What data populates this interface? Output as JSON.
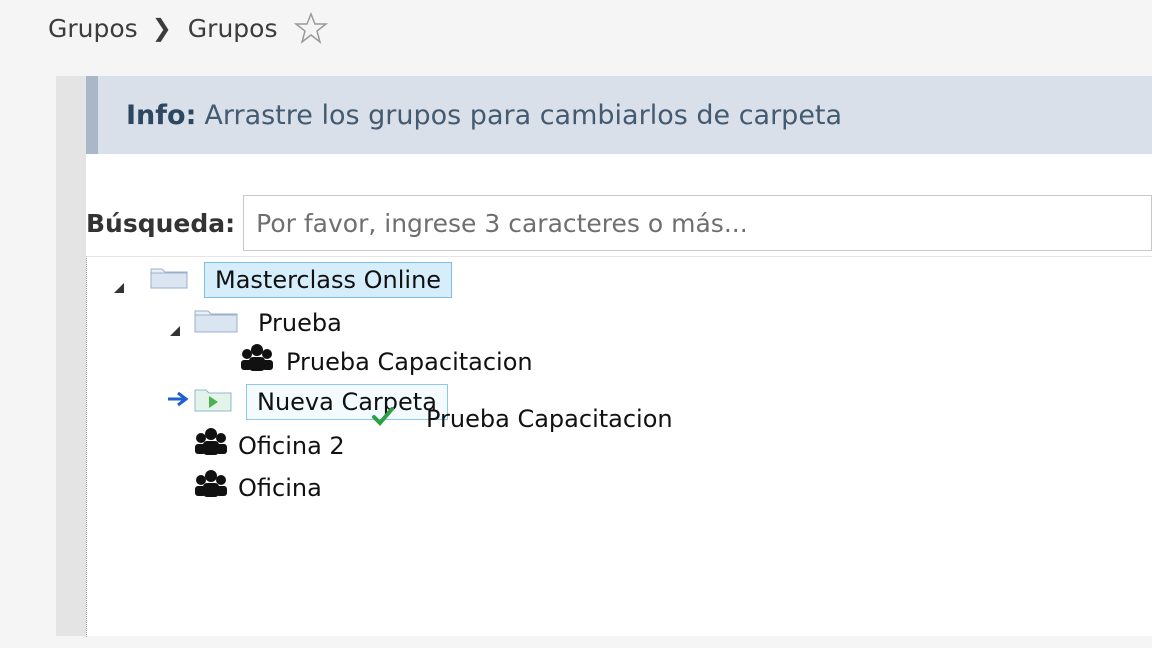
{
  "breadcrumb": {
    "parent": "Grupos",
    "current": "Grupos"
  },
  "info": {
    "label": "Info:",
    "message": "Arrastre los grupos para cambiarlos de carpeta"
  },
  "search": {
    "label": "Búsqueda:",
    "placeholder": "Por favor, ingrese 3 caracteres o más..."
  },
  "tree": {
    "root": "Masterclass Online",
    "folder_prueba": "Prueba",
    "group_prueba_capacitacion": "Prueba Capacitacion",
    "folder_nueva_carpeta": "Nueva Carpeta",
    "group_oficina2": "Oficina 2",
    "group_oficina": "Oficina"
  },
  "drag": {
    "label": "Prueba Capacitacion"
  },
  "colors": {
    "selection_bg": "#d6eefc",
    "selection_border": "#7fbde8",
    "info_bg": "#d9e0ea",
    "drop_arrow": "#1e5fd1",
    "check": "#2ea043"
  }
}
